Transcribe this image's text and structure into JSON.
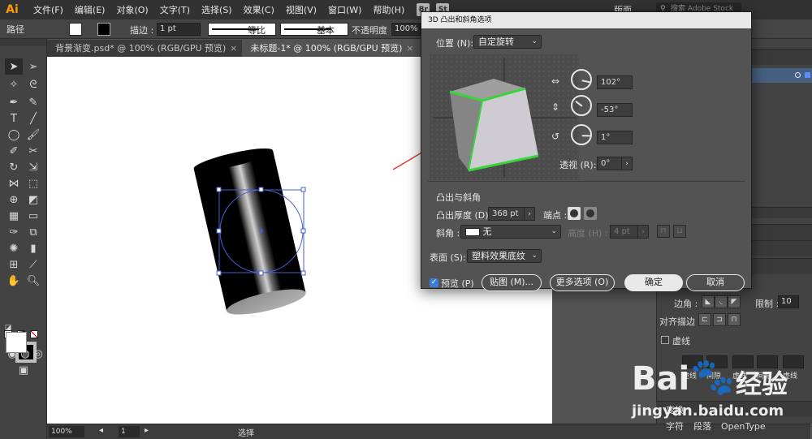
{
  "menubar": {
    "logo": "Ai",
    "items": [
      "文件(F)",
      "编辑(E)",
      "对象(O)",
      "文字(T)",
      "选择(S)",
      "效果(C)",
      "视图(V)",
      "窗口(W)",
      "帮助(H)"
    ],
    "badges": [
      "Br",
      "St"
    ],
    "workspace": "版面",
    "stock_search_placeholder": "搜索 Adobe Stock"
  },
  "controlbar": {
    "object_type": "路径",
    "stroke_label": "描边 :",
    "stroke_value": "1 pt",
    "profile_label": "等比",
    "brush_label": "基本",
    "opacity_label": "不透明度 :",
    "opacity_value": "100%"
  },
  "tabs": [
    {
      "label": "背景渐变.psd* @ 100% (RGB/GPU 预览)"
    },
    {
      "label": "未标题-1* @ 100% (RGB/GPU 预览)"
    }
  ],
  "statusbar": {
    "zoom": "100%",
    "page": "1",
    "tool": "选择"
  },
  "dialog": {
    "title": "3D 凸出和斜角选项",
    "position_label": "位置 (N):",
    "position_value": "自定旋转",
    "rot_x": "102°",
    "rot_y": "-53°",
    "rot_z": "1°",
    "perspective_label": "透视 (R):",
    "perspective_value": "0°",
    "extrude_section": "凸出与斜角",
    "extrude_depth_label": "凸出厚度 (D):",
    "extrude_depth_value": "368 pt",
    "cap_label": "端点 :",
    "bevel_label": "斜角 :",
    "bevel_value": "无",
    "height_label": "高度 (H) :",
    "height_value": "4 pt",
    "surface_label": "表面 (S):",
    "surface_value": "塑料效果底纹",
    "preview_label": "预览 (P)",
    "map_button": "贴图 (M)...",
    "more_options_button": "更多选项 (O)",
    "ok_button": "确定",
    "cancel_button": "取消"
  },
  "right_panel": {
    "corner_label": "边角 :",
    "limit_label": "限制 :",
    "limit_value": "10",
    "align_stroke_label": "对齐描边 :",
    "dashed_label": "虚线",
    "dash_labels": [
      "虚线",
      "间隙",
      "虚线",
      "间隙",
      "虚线",
      "间隙"
    ],
    "transform_label": "变换",
    "bottom_tabs": [
      "字符",
      "段落",
      "OpenType"
    ]
  },
  "watermark": {
    "brand": "Bai",
    "brand_cn": "经验",
    "url": "jingyan.baidu.com"
  },
  "colors": {
    "ui_dark": "#323232",
    "ui_mid": "#434343",
    "canvas": "#535353",
    "artboard": "#ffffff",
    "selection": "#4a5fd6",
    "cube_edge": "#39d43a",
    "arrow": "#e23b3b"
  }
}
